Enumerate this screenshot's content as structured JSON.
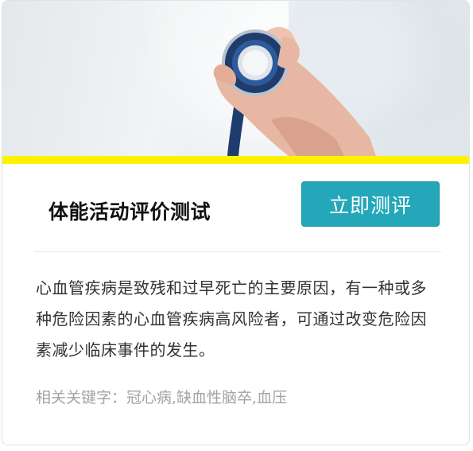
{
  "card": {
    "title": "体能活动评价测试",
    "evaluate_button": "立即测评",
    "description": "心血管疾病是致残和过早死亡的主要原因，有一种或多种危险因素的心血管疾病高风险者，可通过改变危险因素减少临床事件的发生。",
    "keywords_label": "相关关键字：",
    "keywords": "冠心病,缺血性脑卒,血压"
  },
  "colors": {
    "accent_bar": "#fff200",
    "button": "#23a7b9",
    "stethoscope": "#1f3c6e"
  },
  "hero": {
    "image": "doctor-holding-stethoscope"
  }
}
